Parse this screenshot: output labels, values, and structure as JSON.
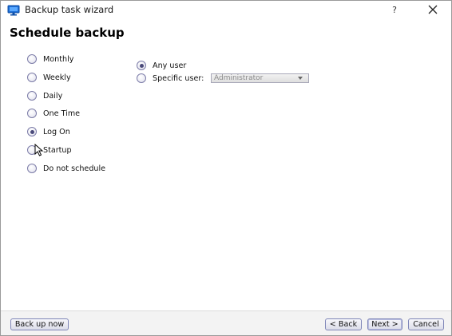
{
  "window": {
    "title": "Backup task wizard",
    "help_label": "?"
  },
  "page": {
    "title": "Schedule backup"
  },
  "schedule_options": [
    {
      "label": "Monthly",
      "checked": false
    },
    {
      "label": "Weekly",
      "checked": false
    },
    {
      "label": "Daily",
      "checked": false
    },
    {
      "label": "One Time",
      "checked": false
    },
    {
      "label": "Log On",
      "checked": true
    },
    {
      "label": "Startup",
      "checked": false
    },
    {
      "label": "Do not schedule",
      "checked": false
    }
  ],
  "user_options": {
    "any_user": {
      "label": "Any user",
      "checked": true
    },
    "specific_user": {
      "label": "Specific user:",
      "checked": false
    }
  },
  "user_select": {
    "value": "Administrator",
    "enabled": false
  },
  "buttons": {
    "back_up_now": "Back up now",
    "back": "< Back",
    "next": "Next >",
    "cancel": "Cancel"
  },
  "colors": {
    "accent": "#7f86b8",
    "title_icon": "#1f6fd6"
  }
}
